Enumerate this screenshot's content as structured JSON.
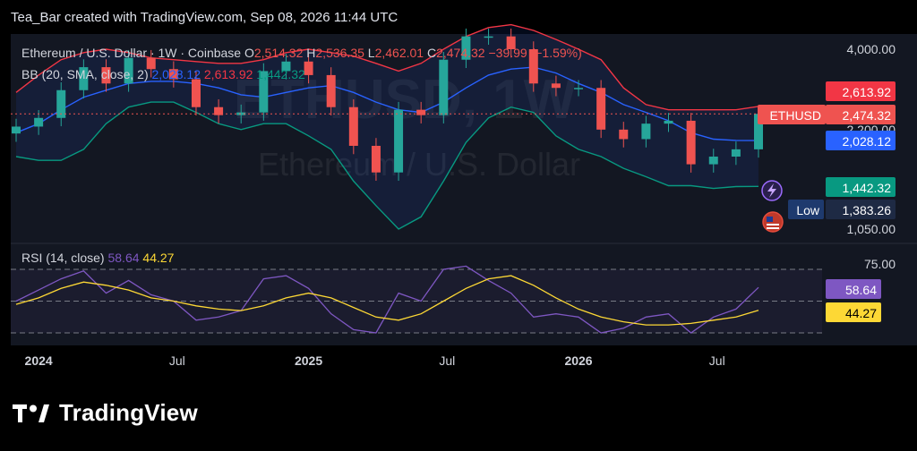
{
  "header": {
    "caption": "Tea_Bar created with TradingView.com, Sep 08, 2026 11:44 UTC"
  },
  "brand": {
    "name": "TradingView"
  },
  "legend": {
    "symbol": "Ethereum / U.S. Dollar · 1W · Coinbase",
    "o_label": "O",
    "o_value": "2,514.32",
    "h_label": "H",
    "h_value": "2,536.35",
    "l_label": "L",
    "l_value": "2,462.01",
    "c_label": "C",
    "c_value": "2,474.32",
    "change": "−39.99 (−1.59%)",
    "bb_label": "BB (20, SMA, close, 2)",
    "bb_basis": "2,028.12",
    "bb_upper": "2,613.92",
    "bb_lower": "1,442.32"
  },
  "watermark": {
    "symbol": "ETHUSD, 1W",
    "name": "Ethereum / U.S. Dollar"
  },
  "price_axis": {
    "ticks": [
      "4,000.00",
      "2,200.00",
      "1,050.00"
    ],
    "badges": {
      "upper": "2,613.92",
      "symbol": "ETHUSD",
      "last": "2,474.32",
      "basis": "2,028.12",
      "lower": "1,442.32",
      "low_label": "Low",
      "low": "1,383.26"
    }
  },
  "rsi": {
    "label": "RSI (14, close)",
    "value": "58.64",
    "ma_value": "44.27",
    "tick": "75.00"
  },
  "time_axis": {
    "labels": [
      "2024",
      "Jul",
      "2025",
      "Jul",
      "2026",
      "Jul"
    ]
  },
  "colors": {
    "background": "#131722",
    "up": "#26a69a",
    "down": "#ef5350",
    "bb_upper": "#f23645",
    "bb_basis": "#2962ff",
    "bb_lower": "#089981",
    "rsi": "#7e57c2",
    "rsi_ma": "#fdd835"
  },
  "chart_data": {
    "type": "candlestick",
    "interval": "1W",
    "scale": "log",
    "y_ticks": [
      4000,
      2200,
      1050
    ],
    "x": [
      "2023-12",
      "2024-01",
      "2024-02",
      "2024-03",
      "2024-04",
      "2024-05",
      "2024-06",
      "2024-07",
      "2024-08",
      "2024-09",
      "2024-10",
      "2024-11",
      "2024-12",
      "2025-01",
      "2025-02",
      "2025-03",
      "2025-04",
      "2025-05",
      "2025-06",
      "2025-07",
      "2025-08",
      "2025-09",
      "2025-10",
      "2025-11",
      "2025-12",
      "2026-01",
      "2026-02",
      "2026-03",
      "2026-04",
      "2026-05",
      "2026-06",
      "2026-07",
      "2026-08",
      "2026-09"
    ],
    "close": [
      2250,
      2400,
      2950,
      3500,
      3100,
      3750,
      3450,
      3200,
      2600,
      2450,
      2500,
      3400,
      3650,
      3300,
      2600,
      1950,
      1600,
      2550,
      2450,
      3700,
      4400,
      4400,
      4000,
      3100,
      3000,
      3000,
      2200,
      2050,
      2300,
      2350,
      1700,
      1800,
      1900,
      2474
    ],
    "bb_upper": [
      2900,
      3300,
      3700,
      3900,
      4000,
      3900,
      3750,
      3700,
      3650,
      3600,
      3600,
      3700,
      3900,
      4000,
      3900,
      3800,
      3600,
      3400,
      3600,
      4000,
      4400,
      4700,
      4800,
      4600,
      4300,
      4000,
      3700,
      3000,
      2650,
      2550,
      2550,
      2550,
      2550,
      2614
    ],
    "bb_basis": [
      2150,
      2300,
      2550,
      2800,
      2950,
      3100,
      3150,
      3150,
      3100,
      3000,
      2850,
      2800,
      2900,
      3000,
      3050,
      2900,
      2700,
      2550,
      2500,
      2700,
      3000,
      3300,
      3450,
      3500,
      3350,
      3100,
      2900,
      2650,
      2500,
      2350,
      2150,
      2050,
      2030,
      2028
    ],
    "bb_lower": [
      1800,
      1750,
      1750,
      1900,
      2300,
      2600,
      2700,
      2700,
      2500,
      2300,
      2200,
      2300,
      2300,
      2100,
      1900,
      1500,
      1250,
      1050,
      1150,
      1500,
      2000,
      2400,
      2600,
      2500,
      2100,
      1900,
      1800,
      1650,
      1550,
      1450,
      1450,
      1420,
      1440,
      1442
    ],
    "rsi": [
      50,
      57,
      64,
      69,
      55,
      63,
      54,
      50,
      38,
      40,
      44,
      64,
      66,
      58,
      42,
      32,
      30,
      55,
      50,
      70,
      72,
      63,
      55,
      40,
      42,
      40,
      30,
      33,
      40,
      42,
      30,
      40,
      45,
      58.64
    ],
    "rsi_ma": [
      48,
      52,
      58,
      62,
      60,
      57,
      52,
      50,
      47,
      45,
      44,
      47,
      52,
      55,
      52,
      46,
      40,
      38,
      42,
      50,
      58,
      64,
      66,
      60,
      52,
      45,
      40,
      37,
      35,
      35,
      36,
      38,
      40,
      44.27
    ]
  }
}
